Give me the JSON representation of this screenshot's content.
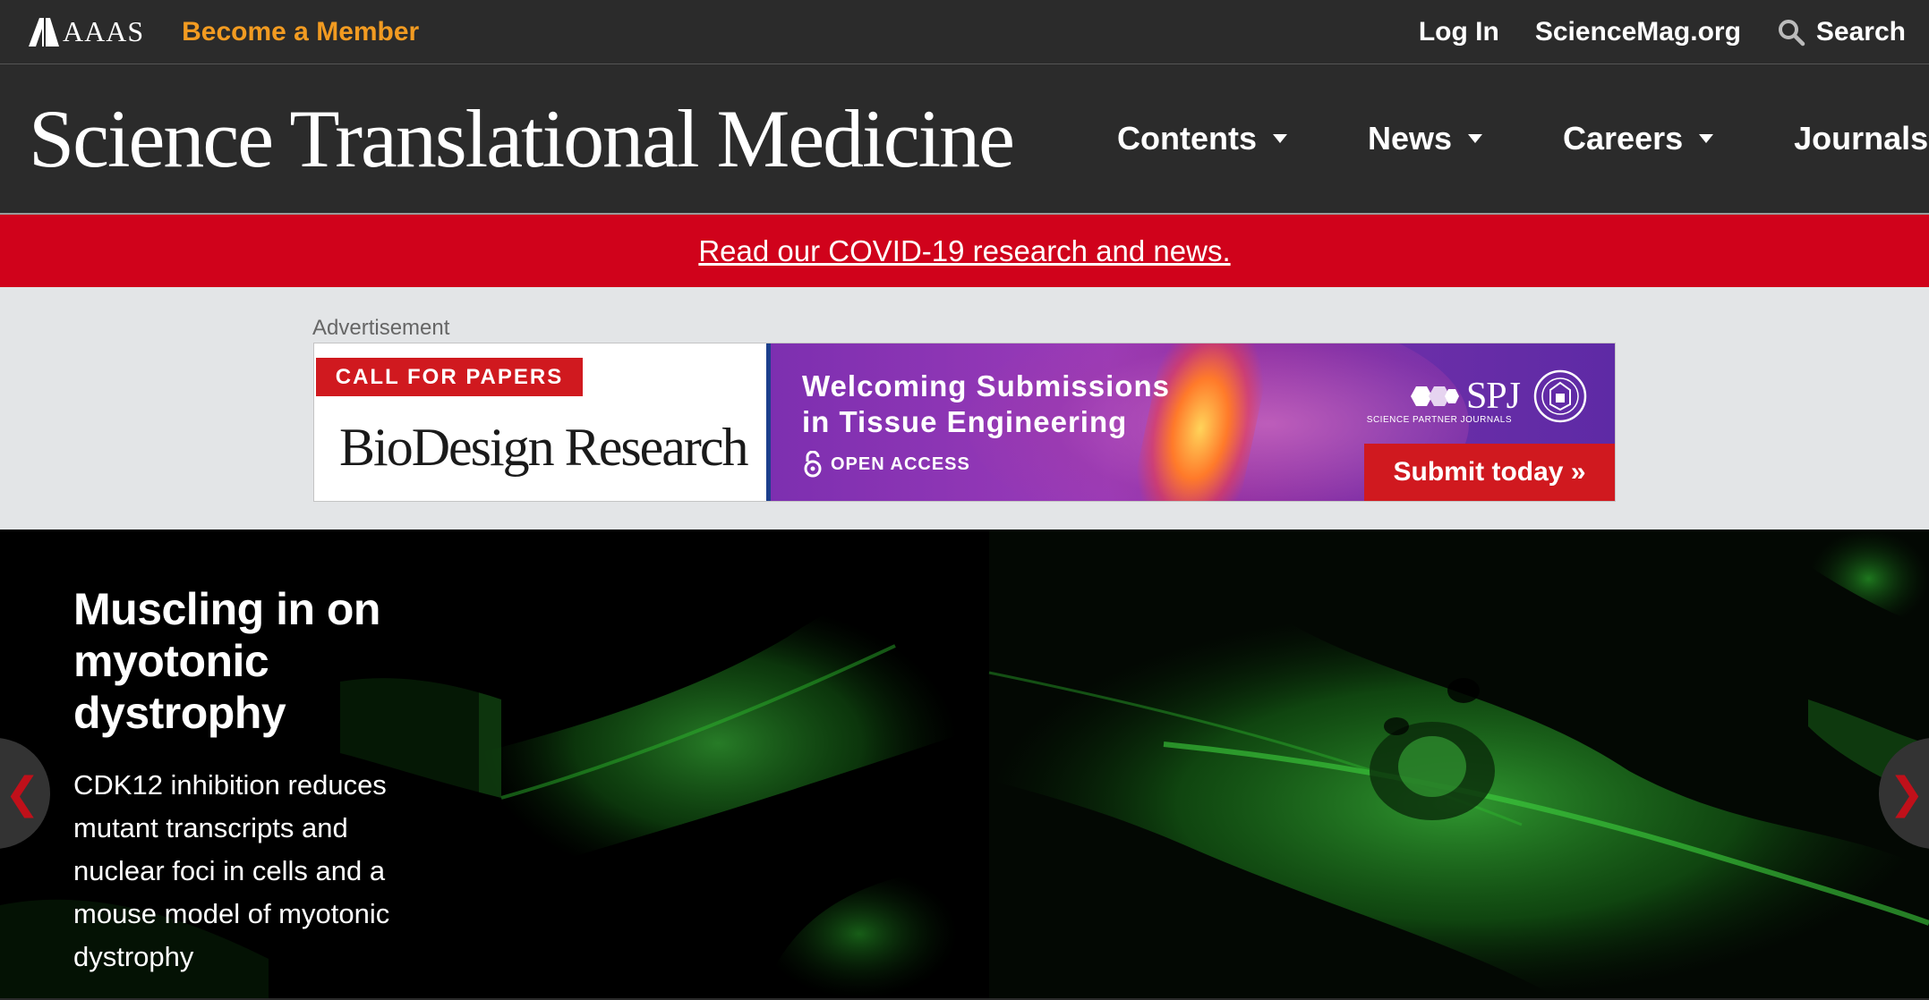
{
  "topbar": {
    "logo_text": "AAAS",
    "become_member": "Become a Member",
    "login": "Log In",
    "sciencemag": "ScienceMag.org",
    "search": "Search"
  },
  "masthead": {
    "title": "Science Translational Medicine",
    "nav": [
      "Contents",
      "News",
      "Careers",
      "Journals"
    ]
  },
  "covid_banner": {
    "text": "Read our COVID-19 research and news."
  },
  "advertisement": {
    "label": "Advertisement",
    "badge": "CALL FOR PAPERS",
    "journal": "BioDesign Research",
    "headline_line1": "Welcoming Submissions",
    "headline_line2": "in Tissue Engineering",
    "open_access": "OPEN ACCESS",
    "publisher": "SPJ",
    "publisher_sub": "SCIENCE PARTNER JOURNALS",
    "cta": "Submit today »"
  },
  "hero": {
    "title": "Muscling in on myotonic dystrophy",
    "description": "CDK12 inhibition reduces mutant transcripts and nuclear foci in cells and a mouse model of myotonic dystrophy",
    "prev_arrow": "❮",
    "next_arrow": "❯"
  },
  "colors": {
    "header_bg": "#2b2b2b",
    "member_orange": "#f29b21",
    "covid_red": "#d0021b",
    "ad_bg": "#e3e5e7",
    "cell_green": "#2fbf2f"
  }
}
